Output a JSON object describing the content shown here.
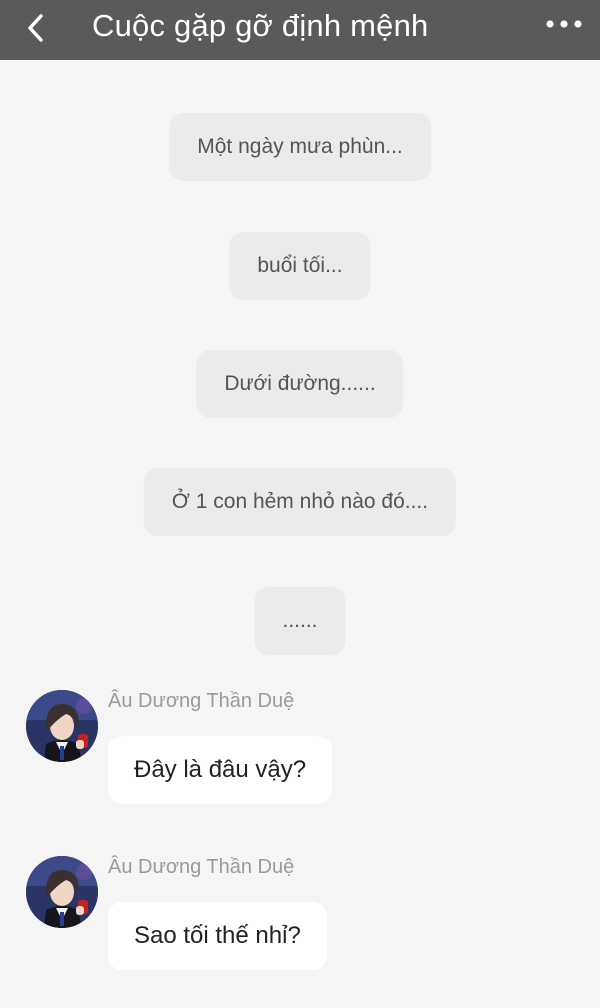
{
  "header": {
    "title": "Cuộc gặp gỡ định mệnh",
    "back_icon": "chevron-left-icon",
    "more_icon": "more-horizontal-icon",
    "background_color": "#5a5a5a"
  },
  "narration": [
    "Một ngày mưa phùn...",
    "buổi tối...",
    "Dưới đường......",
    "Ở 1 con hẻm nhỏ nào đó....",
    "......"
  ],
  "messages": [
    {
      "sender": "Âu Dương Thần Duệ",
      "text": "Đây là đâu vậy?"
    },
    {
      "sender": "Âu Dương Thần Duệ",
      "text": "Sao tối thế nhỉ?"
    }
  ],
  "colors": {
    "page_background": "#f5f5f5",
    "narration_bubble": "#ebebeb",
    "message_bubble": "#ffffff"
  }
}
